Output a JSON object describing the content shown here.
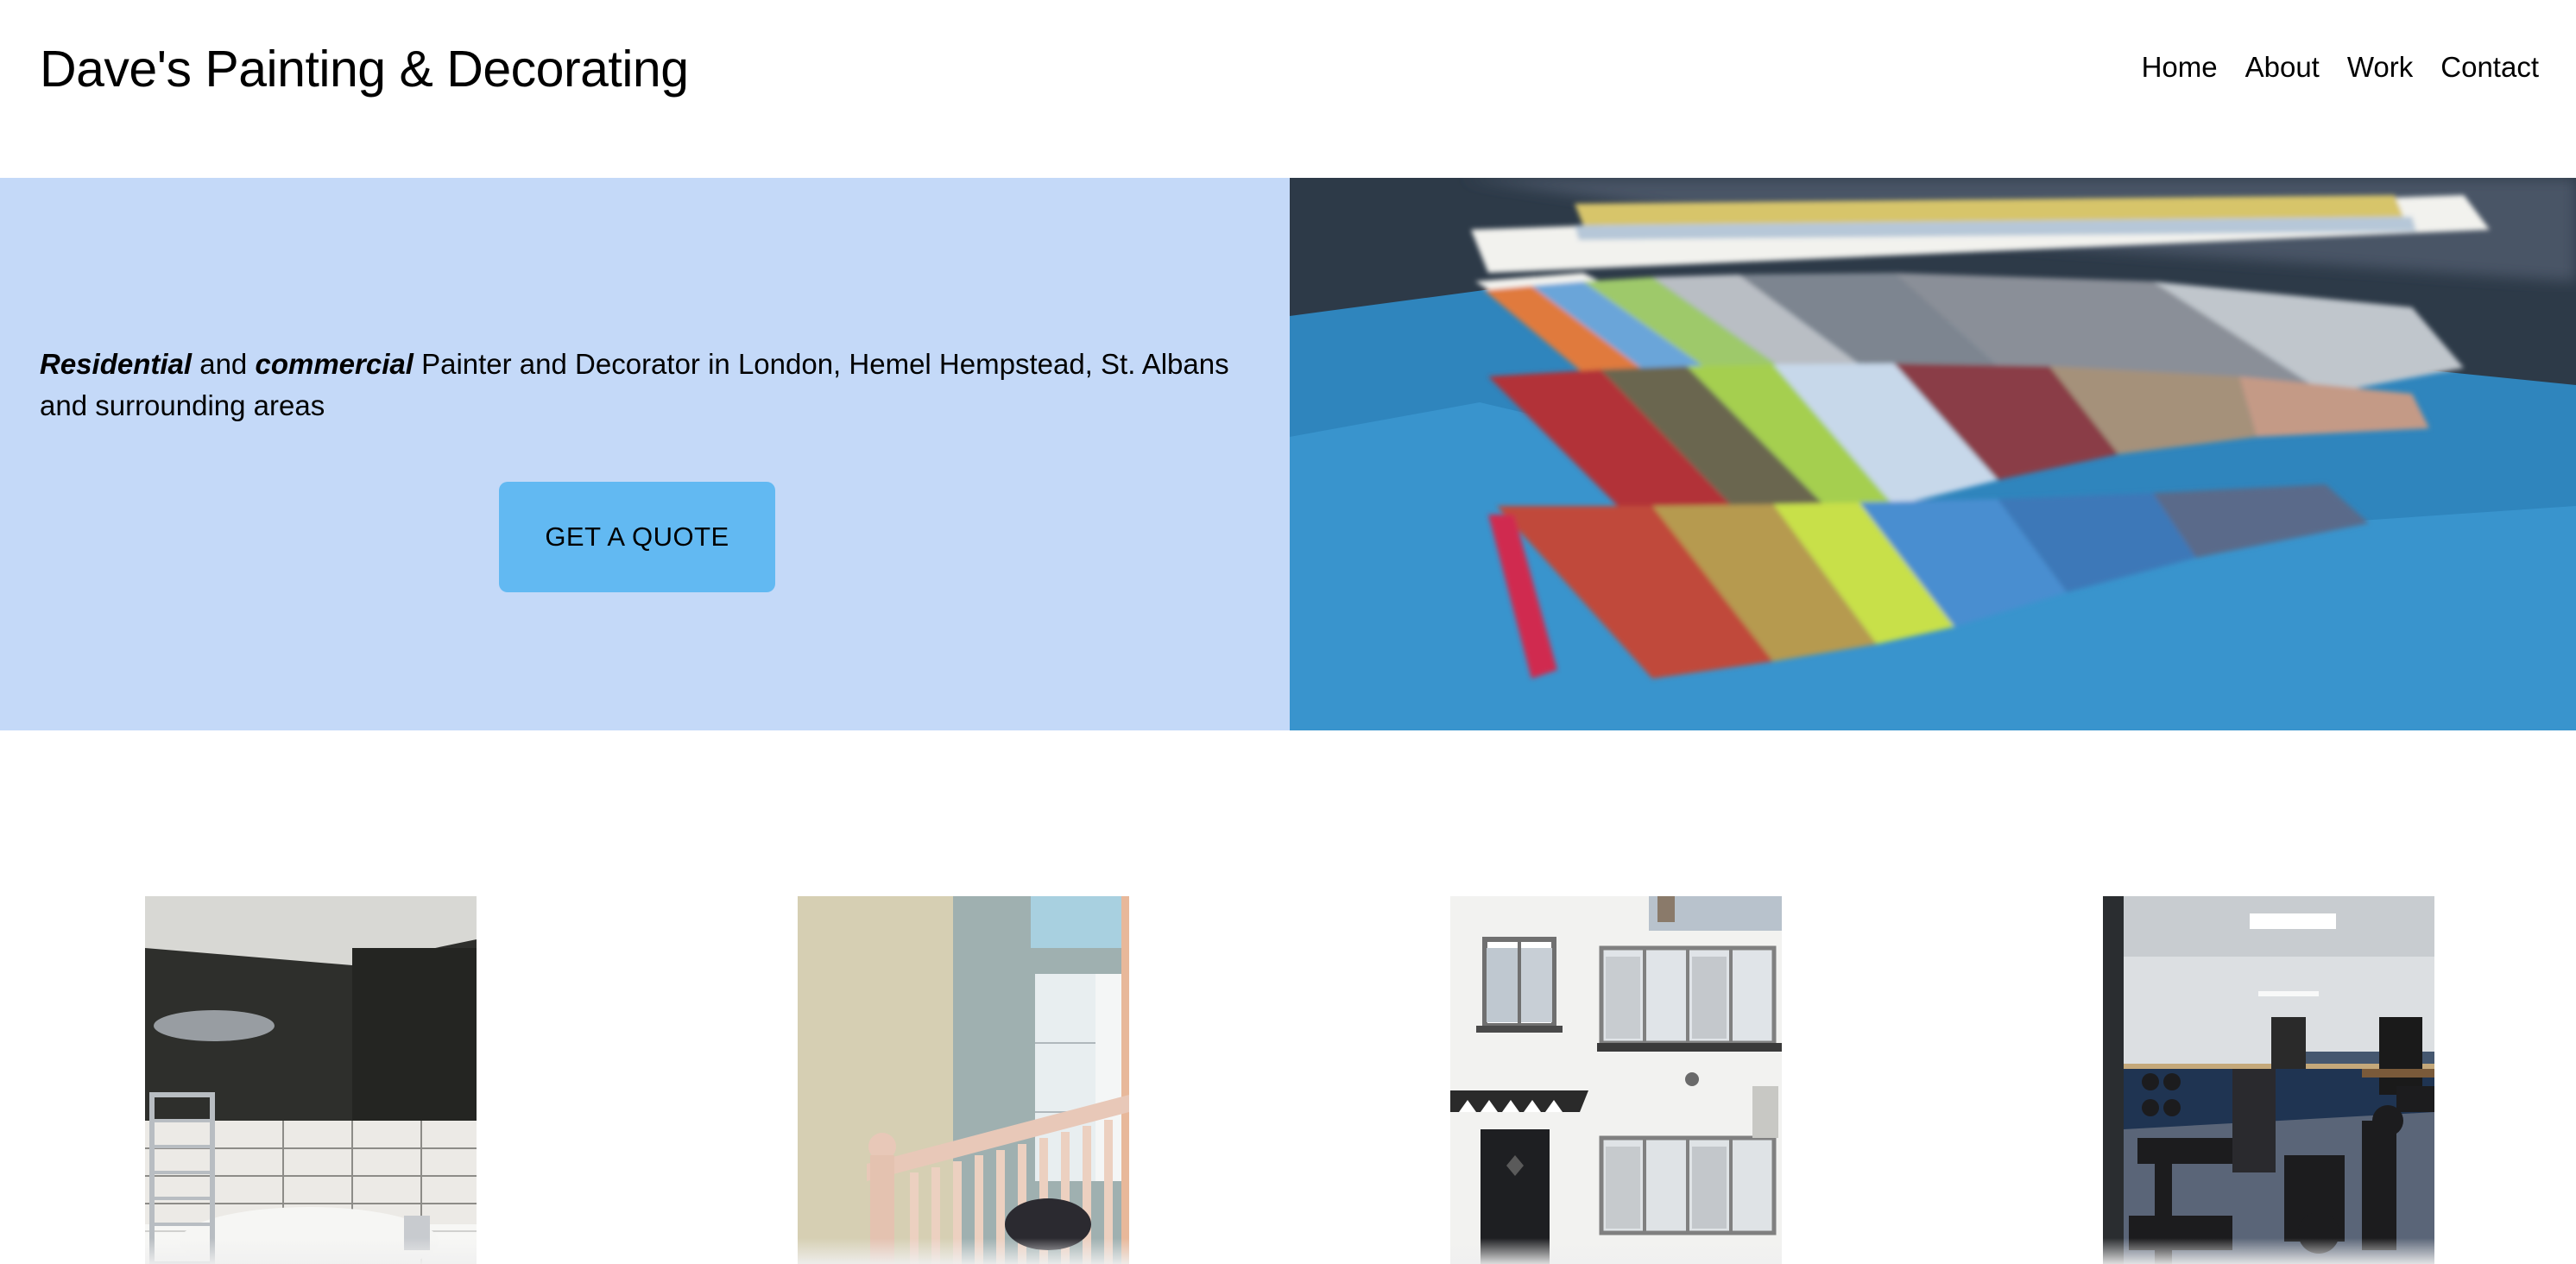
{
  "header": {
    "title": "Dave's Painting & Decorating",
    "nav": [
      "Home",
      "About",
      "Work",
      "Contact"
    ]
  },
  "hero": {
    "tagline_word1": "Residential",
    "tagline_and": " and ",
    "tagline_word2": "commercial",
    "tagline_rest": " Painter and Decorator in London, Hemel Hempstead, St. Albans and surrounding areas",
    "cta_label": "GET A QUOTE",
    "image_subject": "paint-colour-swatch-fan"
  },
  "gallery": {
    "items": [
      {
        "subject": "bathroom-dark-walls"
      },
      {
        "subject": "hallway-staircase"
      },
      {
        "subject": "white-house-exterior"
      },
      {
        "subject": "gym-interior"
      }
    ]
  },
  "colors": {
    "hero_bg": "#c4d9f8",
    "button_bg": "#62b9f2"
  }
}
